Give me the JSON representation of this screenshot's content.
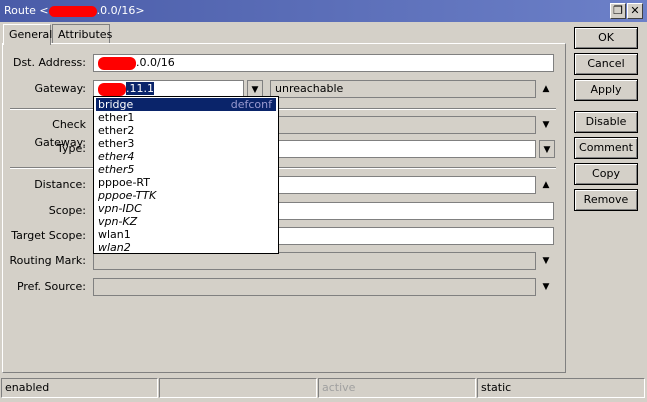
{
  "window": {
    "title_prefix": "Route <",
    "title_suffix": ".0.0/16>",
    "restore_glyph": "❐",
    "close_glyph": "✕"
  },
  "tabs": [
    {
      "label": "General"
    },
    {
      "label": "Attributes"
    }
  ],
  "form": {
    "dst_address": {
      "label": "Dst. Address:",
      "value_suffix": ".0.0/16"
    },
    "gateway": {
      "label": "Gateway:",
      "value_suffix": ".11.1",
      "state": "unreachable"
    },
    "check_gateway": {
      "label": "Check Gateway:"
    },
    "type": {
      "label": "Type:"
    },
    "distance": {
      "label": "Distance:"
    },
    "scope": {
      "label": "Scope:"
    },
    "target_scope": {
      "label": "Target Scope:"
    },
    "routing_mark": {
      "label": "Routing Mark:"
    },
    "pref_source": {
      "label": "Pref. Source:"
    }
  },
  "dropdown": {
    "items": [
      {
        "label": "bridge",
        "hint": "defconf"
      },
      {
        "label": "ether1"
      },
      {
        "label": "ether2"
      },
      {
        "label": "ether3"
      },
      {
        "label": "ether4"
      },
      {
        "label": "ether5"
      },
      {
        "label": "pppoe-RT"
      },
      {
        "label": "pppoe-TTK"
      },
      {
        "label": "vpn-IDC"
      },
      {
        "label": "vpn-KZ"
      },
      {
        "label": "wlan1"
      },
      {
        "label": "wlan2"
      }
    ]
  },
  "buttons": {
    "ok": "OK",
    "cancel": "Cancel",
    "apply": "Apply",
    "disable": "Disable",
    "comment": "Comment",
    "copy": "Copy",
    "remove": "Remove"
  },
  "status": {
    "s1": "enabled",
    "s2": "",
    "s3": "active",
    "s4": "static"
  },
  "colors": {
    "title_bar": "#4a5ca8",
    "selection": "#0a246a",
    "redaction": "#ff0000"
  }
}
